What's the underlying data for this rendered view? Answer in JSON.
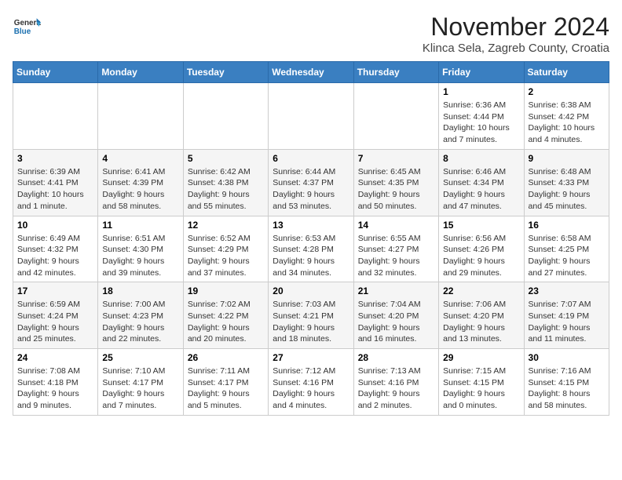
{
  "logo": {
    "general": "General",
    "blue": "Blue"
  },
  "header": {
    "month": "November 2024",
    "location": "Klinca Sela, Zagreb County, Croatia"
  },
  "weekdays": [
    "Sunday",
    "Monday",
    "Tuesday",
    "Wednesday",
    "Thursday",
    "Friday",
    "Saturday"
  ],
  "weeks": [
    [
      {
        "day": "",
        "info": ""
      },
      {
        "day": "",
        "info": ""
      },
      {
        "day": "",
        "info": ""
      },
      {
        "day": "",
        "info": ""
      },
      {
        "day": "",
        "info": ""
      },
      {
        "day": "1",
        "info": "Sunrise: 6:36 AM\nSunset: 4:44 PM\nDaylight: 10 hours and 7 minutes."
      },
      {
        "day": "2",
        "info": "Sunrise: 6:38 AM\nSunset: 4:42 PM\nDaylight: 10 hours and 4 minutes."
      }
    ],
    [
      {
        "day": "3",
        "info": "Sunrise: 6:39 AM\nSunset: 4:41 PM\nDaylight: 10 hours and 1 minute."
      },
      {
        "day": "4",
        "info": "Sunrise: 6:41 AM\nSunset: 4:39 PM\nDaylight: 9 hours and 58 minutes."
      },
      {
        "day": "5",
        "info": "Sunrise: 6:42 AM\nSunset: 4:38 PM\nDaylight: 9 hours and 55 minutes."
      },
      {
        "day": "6",
        "info": "Sunrise: 6:44 AM\nSunset: 4:37 PM\nDaylight: 9 hours and 53 minutes."
      },
      {
        "day": "7",
        "info": "Sunrise: 6:45 AM\nSunset: 4:35 PM\nDaylight: 9 hours and 50 minutes."
      },
      {
        "day": "8",
        "info": "Sunrise: 6:46 AM\nSunset: 4:34 PM\nDaylight: 9 hours and 47 minutes."
      },
      {
        "day": "9",
        "info": "Sunrise: 6:48 AM\nSunset: 4:33 PM\nDaylight: 9 hours and 45 minutes."
      }
    ],
    [
      {
        "day": "10",
        "info": "Sunrise: 6:49 AM\nSunset: 4:32 PM\nDaylight: 9 hours and 42 minutes."
      },
      {
        "day": "11",
        "info": "Sunrise: 6:51 AM\nSunset: 4:30 PM\nDaylight: 9 hours and 39 minutes."
      },
      {
        "day": "12",
        "info": "Sunrise: 6:52 AM\nSunset: 4:29 PM\nDaylight: 9 hours and 37 minutes."
      },
      {
        "day": "13",
        "info": "Sunrise: 6:53 AM\nSunset: 4:28 PM\nDaylight: 9 hours and 34 minutes."
      },
      {
        "day": "14",
        "info": "Sunrise: 6:55 AM\nSunset: 4:27 PM\nDaylight: 9 hours and 32 minutes."
      },
      {
        "day": "15",
        "info": "Sunrise: 6:56 AM\nSunset: 4:26 PM\nDaylight: 9 hours and 29 minutes."
      },
      {
        "day": "16",
        "info": "Sunrise: 6:58 AM\nSunset: 4:25 PM\nDaylight: 9 hours and 27 minutes."
      }
    ],
    [
      {
        "day": "17",
        "info": "Sunrise: 6:59 AM\nSunset: 4:24 PM\nDaylight: 9 hours and 25 minutes."
      },
      {
        "day": "18",
        "info": "Sunrise: 7:00 AM\nSunset: 4:23 PM\nDaylight: 9 hours and 22 minutes."
      },
      {
        "day": "19",
        "info": "Sunrise: 7:02 AM\nSunset: 4:22 PM\nDaylight: 9 hours and 20 minutes."
      },
      {
        "day": "20",
        "info": "Sunrise: 7:03 AM\nSunset: 4:21 PM\nDaylight: 9 hours and 18 minutes."
      },
      {
        "day": "21",
        "info": "Sunrise: 7:04 AM\nSunset: 4:20 PM\nDaylight: 9 hours and 16 minutes."
      },
      {
        "day": "22",
        "info": "Sunrise: 7:06 AM\nSunset: 4:20 PM\nDaylight: 9 hours and 13 minutes."
      },
      {
        "day": "23",
        "info": "Sunrise: 7:07 AM\nSunset: 4:19 PM\nDaylight: 9 hours and 11 minutes."
      }
    ],
    [
      {
        "day": "24",
        "info": "Sunrise: 7:08 AM\nSunset: 4:18 PM\nDaylight: 9 hours and 9 minutes."
      },
      {
        "day": "25",
        "info": "Sunrise: 7:10 AM\nSunset: 4:17 PM\nDaylight: 9 hours and 7 minutes."
      },
      {
        "day": "26",
        "info": "Sunrise: 7:11 AM\nSunset: 4:17 PM\nDaylight: 9 hours and 5 minutes."
      },
      {
        "day": "27",
        "info": "Sunrise: 7:12 AM\nSunset: 4:16 PM\nDaylight: 9 hours and 4 minutes."
      },
      {
        "day": "28",
        "info": "Sunrise: 7:13 AM\nSunset: 4:16 PM\nDaylight: 9 hours and 2 minutes."
      },
      {
        "day": "29",
        "info": "Sunrise: 7:15 AM\nSunset: 4:15 PM\nDaylight: 9 hours and 0 minutes."
      },
      {
        "day": "30",
        "info": "Sunrise: 7:16 AM\nSunset: 4:15 PM\nDaylight: 8 hours and 58 minutes."
      }
    ]
  ]
}
